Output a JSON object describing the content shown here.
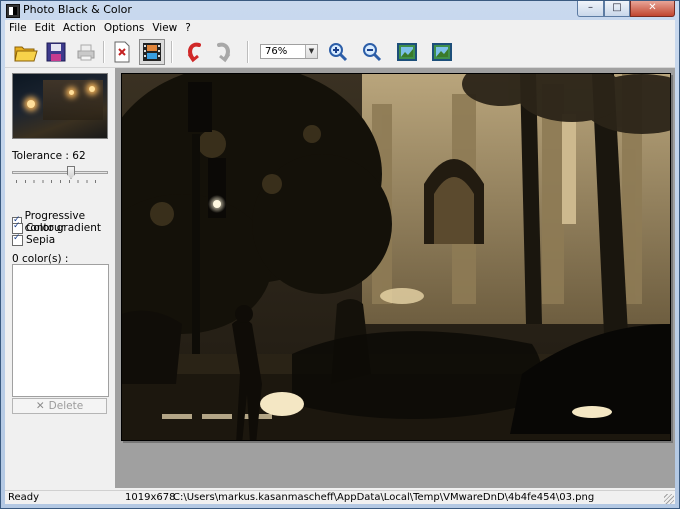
{
  "window": {
    "title": "Photo Black & Color",
    "buttons": {
      "minimize": "–",
      "maximize": "□",
      "close": "✕"
    }
  },
  "menu": [
    "File",
    "Edit",
    "Action",
    "Options",
    "View",
    "?"
  ],
  "toolbar": {
    "zoom_value": "76%",
    "icons": [
      "open-folder-icon",
      "save-disk-icon",
      "print-icon",
      "page-export-icon",
      "film-icon",
      "undo-icon",
      "redo-icon",
      "zoom-in-icon",
      "zoom-out-icon",
      "fit-window-icon",
      "actual-size-icon"
    ]
  },
  "panel": {
    "tolerance_label": "Tolerance : 62",
    "tolerance_value": 62,
    "checks": [
      "Progressive contour",
      "Color gradient",
      "Sepia"
    ],
    "colors_label": "0 color(s) :",
    "delete_label": "Delete"
  },
  "status": {
    "state": "Ready",
    "dimensions": "1019x678",
    "path": "C:\\Users\\markus.kasanmascheff\\AppData\\Local\\Temp\\VMwareDnD\\4b4fe454\\03.png"
  },
  "colors": {
    "sepia_dark": "#2b2418",
    "sepia_light": "#d9c9a4",
    "title_bg": "#c2d5ec",
    "close_red": "#c1452f"
  }
}
